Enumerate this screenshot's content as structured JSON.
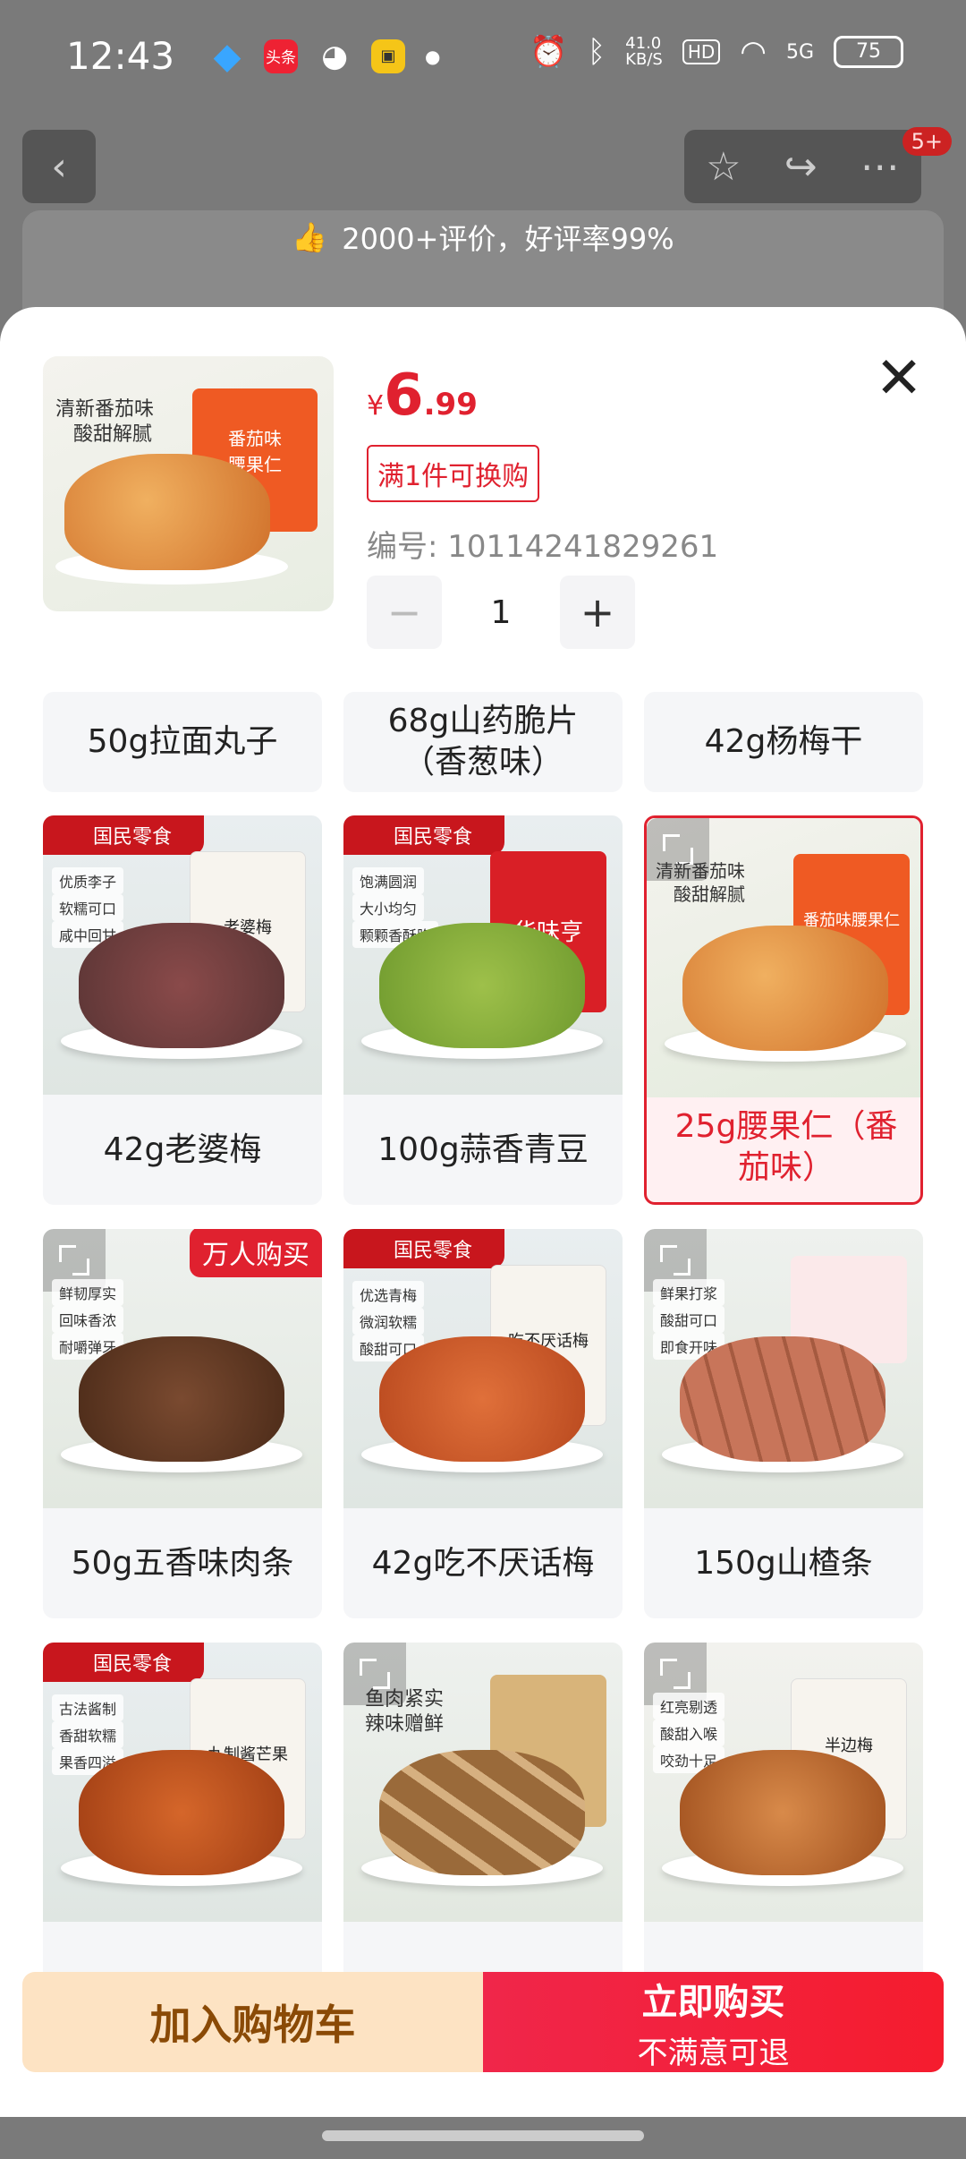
{
  "status": {
    "time": "12:43",
    "app_toutiao": "头条",
    "speed": "41.0\nKB/S",
    "hd": "HD",
    "net": "5G",
    "battery": "75"
  },
  "topbar": {
    "badge": "5+",
    "ribbon": "2000+评价，好评率99%"
  },
  "product": {
    "img_text_1": "清新番茄味",
    "img_text_2": "酸甜解腻",
    "pkg_text": "番茄味\n腰果仁",
    "currency": "¥",
    "price_int": "6",
    "price_dec": ".99",
    "tag": "满1件可换购",
    "code": "编号: 10114241829261",
    "qty": "1",
    "minus": "−",
    "plus": "+"
  },
  "brand_tag": "国民零食",
  "grid": [
    {
      "label": "50g拉面丸子"
    },
    {
      "label": "68g山药脆片（香葱味）"
    },
    {
      "label": "42g杨梅干"
    },
    {
      "label": "42g老婆梅",
      "feats": [
        "优质李子",
        "软糯可口",
        "咸中回甘"
      ],
      "pkg": "老婆梅"
    },
    {
      "label": "100g蒜香青豆",
      "feats": [
        "饱满圆润",
        "大小均匀",
        "颗颗香酥脆"
      ],
      "pkg": "华味亨"
    },
    {
      "label": "25g腰果仁（番茄味）",
      "feats": [
        "清新番茄味",
        "酸甜解腻"
      ],
      "pkg": "番茄味腰果仁"
    },
    {
      "label": "50g五香味肉条",
      "feats": [
        "鲜韧厚实",
        "回味香浓",
        "耐嚼弹牙"
      ],
      "hot": "万人购买"
    },
    {
      "label": "42g吃不厌话梅",
      "feats": [
        "优选青梅",
        "微润软糯",
        "酸甜可口"
      ],
      "pkg": "吃不厌话梅"
    },
    {
      "label": "150g山楂条",
      "feats": [
        "鲜果打浆",
        "酸甜可口",
        "即食开味"
      ]
    },
    {
      "label": "",
      "feats": [
        "古法酱制",
        "香甜软糯",
        "果香四溢"
      ],
      "pkg": "九制酱芒果"
    },
    {
      "label": "",
      "feats": [
        "鱼肉紧实",
        "辣味赠鲜"
      ]
    },
    {
      "label": "",
      "feats": [
        "红亮剔透",
        "酸甜入喉",
        "咬劲十足"
      ],
      "pkg": "半边梅"
    }
  ],
  "bottom": {
    "add_cart": "加入购物车",
    "buy_now": "立即购买",
    "buy_sub": "不满意可退"
  }
}
